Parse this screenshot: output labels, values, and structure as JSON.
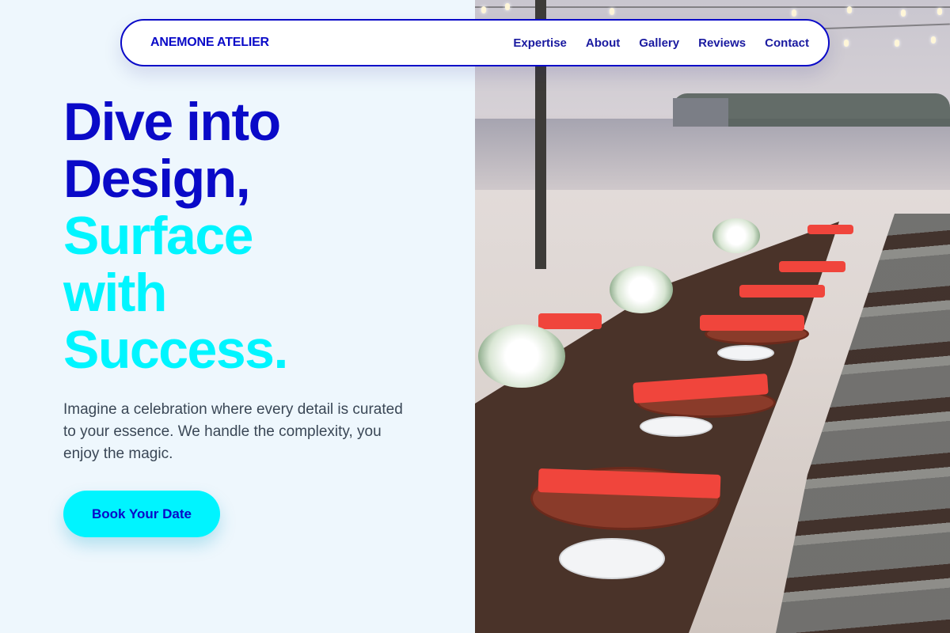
{
  "brand": "ANEMONE ATELIER",
  "nav": [
    "Expertise",
    "About",
    "Gallery",
    "Reviews",
    "Contact"
  ],
  "hero": {
    "headline_line1": "Dive into",
    "headline_line2": "Design,",
    "headline_line3": "Surface",
    "headline_line4": "with",
    "headline_line5": "Success.",
    "subtitle": "Imagine a celebration where every detail is curated to your essence. We handle the complexity, you enjoy the magic.",
    "cta_label": "Book Your Date"
  },
  "colors": {
    "primary": "#0a0ac8",
    "accent": "#00f4ff",
    "background": "#eef7fd",
    "text": "#3a4756"
  },
  "image": {
    "alt": "Long dining table with red napkins and chairs on a beach"
  }
}
